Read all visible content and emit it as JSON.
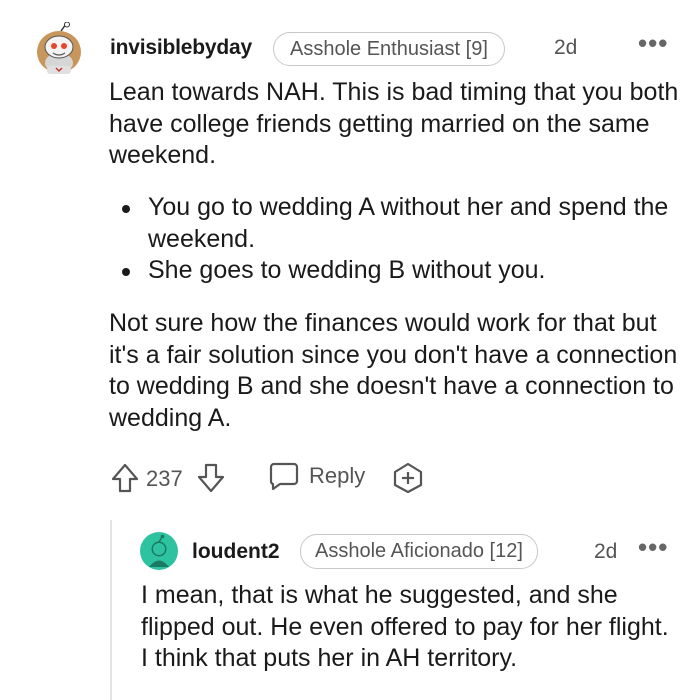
{
  "comment": {
    "username": "invisiblebyday",
    "flair": "Asshole Enthusiast [9]",
    "time": "2d",
    "paragraph1": "Lean towards NAH. This is bad timing that you both have college friends getting married on the same weekend.",
    "bullets": [
      "You go to wedding A without her and spend the weekend.",
      "She goes to wedding B without you."
    ],
    "paragraph2": "Not sure how the finances would work for that but it's a fair solution since you don't have a connection to wedding B and she doesn't have a connection to wedding A.",
    "score": "237",
    "reply_label": "Reply",
    "upvote_icon": "arrow-up-outline-icon",
    "downvote_icon": "arrow-down-outline-icon",
    "reply_icon": "speech-bubble-icon",
    "award_icon": "award-plus-icon"
  },
  "reply": {
    "username": "loudent2",
    "flair": "Asshole Aficionado [12]",
    "time": "2d",
    "body": "I mean, that is what he suggested, and she flipped out. He even offered to pay for her flight. I think that puts her in AH territory."
  },
  "colors": {
    "text": "#1a1a1b",
    "meta": "#555555",
    "avatar2_bg": "#2ec3a0"
  }
}
